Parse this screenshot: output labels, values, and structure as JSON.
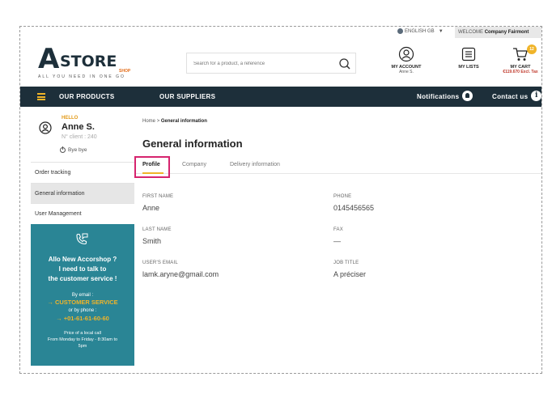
{
  "topbar": {
    "language": "ENGLISH GB",
    "welcome_prefix": "WELCOME",
    "welcome_name": "Company Fairmont"
  },
  "header": {
    "logo_letter": "A",
    "logo_word": "STORE",
    "logo_shop": "SHOP",
    "logo_tagline": "ALL YOU NEED IN ONE GO",
    "search_placeholder": "Search for a product, a reference",
    "account_label": "MY ACCOUNT",
    "account_user": "Anne S.",
    "lists_label": "MY LISTS",
    "cart_label": "MY CART",
    "cart_total": "€119.670 Excl. Tax",
    "cart_count": "12"
  },
  "nav": {
    "products": "OUR PRODUCTS",
    "suppliers": "OUR SUPPLIERS",
    "notifications": "Notifications",
    "contact": "Contact us"
  },
  "sidebar": {
    "hello": "HELLO",
    "name": "Anne S.",
    "client": "N° client : 240",
    "bye": "Bye bye",
    "items": [
      {
        "label": "Order tracking"
      },
      {
        "label": "General information"
      },
      {
        "label": "User Management"
      }
    ],
    "service": {
      "line1": "Allo New Accorshop ?",
      "line2": "I need to talk to",
      "line3": "the customer service !",
      "by_email": "By email :",
      "email_link": "CUSTOMER SERVICE",
      "by_phone": "or by phone :",
      "phone_link": "+01-61-61-60-60",
      "price": "Price of a local call",
      "hours1": "From Monday to Friday - 8:30am to",
      "hours2": "5pm"
    }
  },
  "main": {
    "breadcrumb_home": "Home",
    "breadcrumb_sep": ">",
    "breadcrumb_current": "General information",
    "title": "General information",
    "tabs": [
      {
        "label": "Profile"
      },
      {
        "label": "Company"
      },
      {
        "label": "Delivery information"
      }
    ],
    "fields": {
      "first_name_label": "FIRST NAME",
      "first_name": "Anne",
      "phone_label": "PHONE",
      "phone": "0145456565",
      "last_name_label": "LAST NAME",
      "last_name": "Smith",
      "fax_label": "FAX",
      "fax": "—",
      "email_label": "USER'S EMAIL",
      "email": "lamk.aryne@gmail.com",
      "job_label": "JOB TITLE",
      "job": "A préciser"
    }
  },
  "colors": {
    "navy": "#1d2f3a",
    "accent": "#f0b429",
    "teal": "#2a8595",
    "highlight": "#d6246e"
  }
}
